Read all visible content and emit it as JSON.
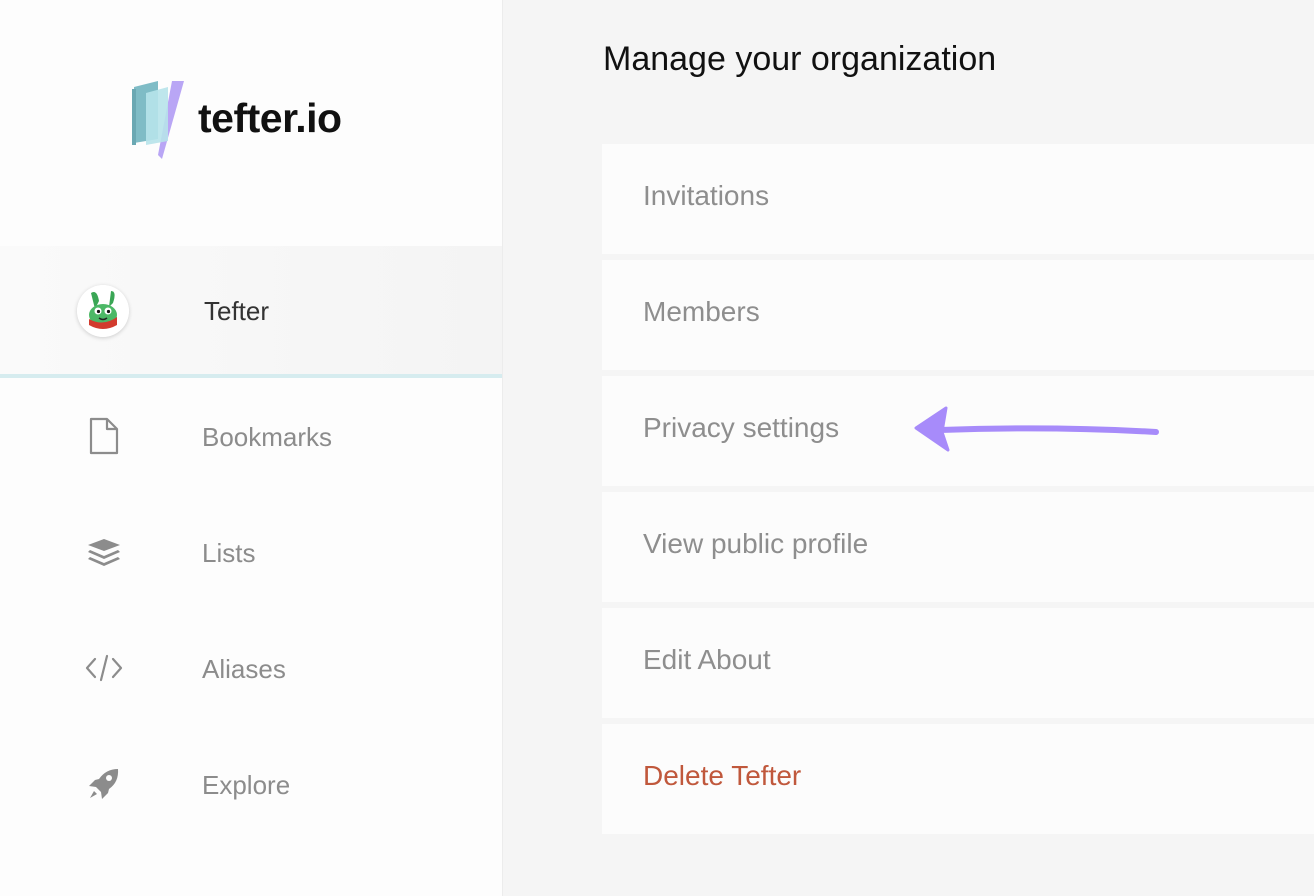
{
  "brand": {
    "name": "tefter.io",
    "accent": "#7fbcc6",
    "accent_purple": "#a78bfa"
  },
  "sidebar": {
    "organization": {
      "name": "Tefter",
      "avatar": "frog-mascot-avatar"
    },
    "items": [
      {
        "label": "Bookmarks",
        "icon": "document-icon"
      },
      {
        "label": "Lists",
        "icon": "layers-icon"
      },
      {
        "label": "Aliases",
        "icon": "code-icon"
      },
      {
        "label": "Explore",
        "icon": "rocket-icon"
      }
    ]
  },
  "main": {
    "title": "Manage your organization",
    "options": [
      {
        "label": "Invitations"
      },
      {
        "label": "Members"
      },
      {
        "label": "Privacy settings"
      },
      {
        "label": "View public profile"
      },
      {
        "label": "Edit About"
      },
      {
        "label": "Delete Tefter",
        "danger_color": "#c0583c"
      }
    ],
    "annotation": "hand-drawn-purple-arrow-pointing-left"
  }
}
